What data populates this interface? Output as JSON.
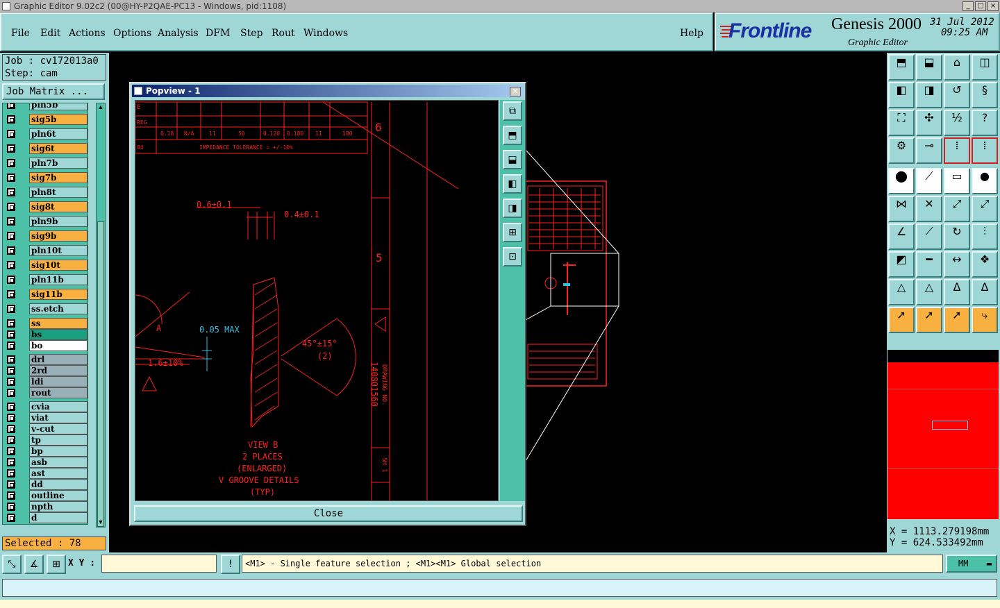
{
  "window": {
    "title": "Graphic Editor 9.02c2 (00@HY-P2QAE-PC13 - Windows, pid:1108)",
    "controls": [
      "_",
      "□",
      "×"
    ]
  },
  "menubar": {
    "items": [
      "File",
      "Edit",
      "Actions",
      "Options",
      "Analysis",
      "DFM",
      "Step",
      "Rout",
      "Windows"
    ],
    "help": "Help"
  },
  "brand": {
    "logo": "Frontline",
    "product": "Genesis 2000",
    "subtitle": "Graphic Editor",
    "date": "31 Jul 2012",
    "time": "09:25 AM"
  },
  "job": {
    "job_line": "Job : cv172013a0",
    "step_line": "Step: cam",
    "matrix_button": "Job Matrix ..."
  },
  "layers": [
    {
      "name": "pln5b",
      "style": "plain"
    },
    {
      "name": "sig5b",
      "style": "sig"
    },
    {
      "name": "pln6t",
      "style": "plain"
    },
    {
      "name": "sig6t",
      "style": "sig"
    },
    {
      "name": "pln7b",
      "style": "plain"
    },
    {
      "name": "sig7b",
      "style": "sig"
    },
    {
      "name": "pln8t",
      "style": "plain"
    },
    {
      "name": "sig8t",
      "style": "sig"
    },
    {
      "name": "pln9b",
      "style": "plain"
    },
    {
      "name": "sig9b",
      "style": "sig"
    },
    {
      "name": "pln10t",
      "style": "plain"
    },
    {
      "name": "sig10t",
      "style": "sig"
    },
    {
      "name": "pln11b",
      "style": "plain"
    },
    {
      "name": "sig11b",
      "style": "sig"
    },
    {
      "name": "ss.etch",
      "style": "plain"
    },
    {
      "name": "ss",
      "style": "sig"
    },
    {
      "name": "bs",
      "style": "bs"
    },
    {
      "name": "bo",
      "style": "bo"
    },
    {
      "name": "drl",
      "style": "grey"
    },
    {
      "name": "2rd",
      "style": "grey"
    },
    {
      "name": "ldi",
      "style": "grey"
    },
    {
      "name": "rout",
      "style": "grey"
    },
    {
      "name": "cvia",
      "style": "plain"
    },
    {
      "name": "viat",
      "style": "plain"
    },
    {
      "name": "v-cut",
      "style": "plain"
    },
    {
      "name": "tp",
      "style": "plain"
    },
    {
      "name": "bp",
      "style": "plain"
    },
    {
      "name": "asb",
      "style": "plain"
    },
    {
      "name": "ast",
      "style": "plain"
    },
    {
      "name": "dd",
      "style": "plain"
    },
    {
      "name": "outline",
      "style": "plain"
    },
    {
      "name": "npth",
      "style": "plain"
    },
    {
      "name": "d",
      "style": "plain"
    }
  ],
  "selected": "Selected : 78",
  "popview": {
    "title": "Popview - 1",
    "close_button": "Close",
    "drawing": {
      "table_row_labels": [
        "E",
        "REG",
        "84"
      ],
      "table_values": [
        "0.18",
        "N/A",
        "11",
        "50",
        "0.120",
        "0.180",
        "11",
        "180"
      ],
      "impedance_note": "IMPEDANCE TOLERANCE = +/-10%",
      "dim1": "0.6±0.1",
      "dim2": "0.4±0.1",
      "dim3": "0.05 MAX",
      "dim4": "1.6±10%",
      "angle": "45°±15°",
      "angle_note": "(2)",
      "view_lines": [
        "VIEW B",
        "2 PLACES",
        "(ENLARGED)",
        "V GROOVE DETAILS",
        "(TYP)"
      ],
      "drawing_no_label": "DRAWING NO.",
      "drawing_no": "140801560",
      "zone_6": "6",
      "zone_5": "5",
      "sheet": "SH 1",
      "marker_a": "A"
    }
  },
  "coords": {
    "x": "X = 1113.279198mm",
    "y": "Y =  624.533492mm"
  },
  "bottombar": {
    "xy_label": "X Y :",
    "xy_value": "",
    "info_icon": "!",
    "status": "<M1> - Single feature selection ; <M1><M1> Global selection",
    "units": "MM"
  },
  "colors": {
    "panel": "#9fd6d6",
    "accent_orange": "#f8b040",
    "layer_green": "#4dc0a8",
    "drawing_red": "#ff2020",
    "dimension_cyan": "#30c0e0",
    "overview_red": "#ff0000"
  }
}
